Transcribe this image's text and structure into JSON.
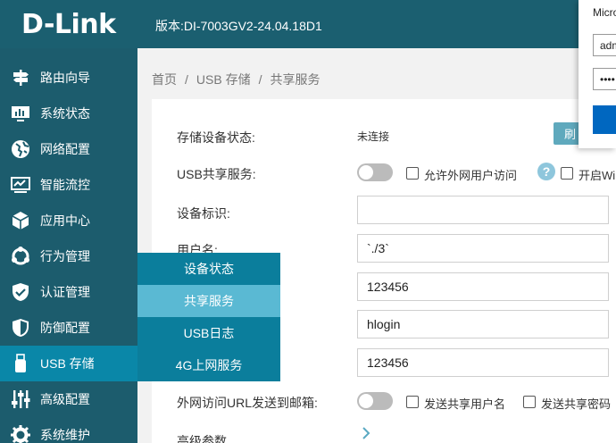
{
  "header": {
    "logo": "D-Link",
    "version": "版本:DI-7003GV2-24.04.18D1"
  },
  "sidebar": {
    "items": [
      {
        "label": "路由向导",
        "icon": "signpost-icon"
      },
      {
        "label": "系统状态",
        "icon": "monitor-chart-icon"
      },
      {
        "label": "网络配置",
        "icon": "globe-icon"
      },
      {
        "label": "智能流控",
        "icon": "traffic-monitor-icon"
      },
      {
        "label": "应用中心",
        "icon": "cube-icon"
      },
      {
        "label": "行为管理",
        "icon": "users-cycle-icon"
      },
      {
        "label": "认证管理",
        "icon": "shield-check-icon"
      },
      {
        "label": "防御配置",
        "icon": "shield-half-icon"
      },
      {
        "label": "USB 存储",
        "icon": "usb-drive-icon"
      },
      {
        "label": "高级配置",
        "icon": "sliders-icon"
      },
      {
        "label": "系统维护",
        "icon": "gear-icon"
      }
    ]
  },
  "submenu": {
    "items": [
      "设备状态",
      "共享服务",
      "USB日志",
      "4G上网服务"
    ]
  },
  "breadcrumb": {
    "home": "首页",
    "section": "USB 存储",
    "page": "共享服务",
    "separator": "/"
  },
  "form": {
    "storage_status_label": "存储设备状态:",
    "storage_status_value": "未连接",
    "refresh_label": "刷",
    "usb_share_label": "USB共享服务:",
    "allow_wan_label": "允许外网用户访问",
    "enable_wifi_label": "开启Wi",
    "device_id_label": "设备标识:",
    "device_id_value": "",
    "username_label": "用户名:",
    "username_value": "`./3`",
    "password_value": "123456",
    "login_value": "hlogin",
    "pass2_value": "123456",
    "email_label": "外网访问URL发送到邮箱:",
    "send_user_label": "发送共享用户名",
    "send_pass_label": "发送共享密码",
    "advanced_label": "高级参数"
  },
  "popup": {
    "title": "Micro",
    "user_value": "adm",
    "password_mask": "••••"
  },
  "colors": {
    "header": "#1b5f70",
    "sidebar": "#1c5c6d",
    "active": "#0a87a8",
    "submenu": "#0b7e9c",
    "submenu_selected": "#5ab9d3"
  }
}
